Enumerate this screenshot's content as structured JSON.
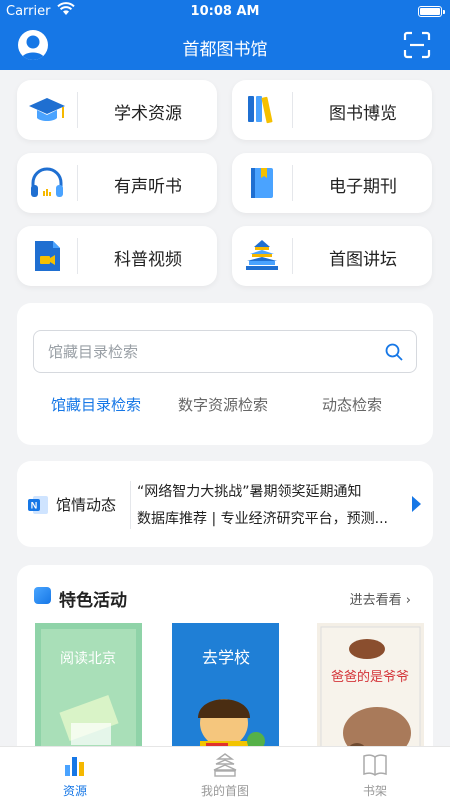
{
  "status_bar": {
    "carrier": "Carrier",
    "time": "10:08 AM"
  },
  "header": {
    "title": "首都图书馆",
    "avatar_icon": "user-avatar-icon",
    "scan_icon": "scan-icon"
  },
  "grid": [
    {
      "label": "学术资源",
      "icon": "graduation-cap-icon"
    },
    {
      "label": "图书博览",
      "icon": "books-icon"
    },
    {
      "label": "有声听书",
      "icon": "headphones-icon"
    },
    {
      "label": "电子期刊",
      "icon": "ebook-icon"
    },
    {
      "label": "科普视频",
      "icon": "video-file-icon"
    },
    {
      "label": "首图讲坛",
      "icon": "temple-icon"
    }
  ],
  "search": {
    "placeholder": "馆藏目录检索",
    "tabs": [
      "馆藏目录检索",
      "数字资源检索",
      "动态检索"
    ],
    "active_tab": "馆藏目录检索"
  },
  "news": {
    "label": "馆情动态",
    "items": [
      "“网络智力大挑战”暑期领奖延期通知",
      "数据库推荐 | 专业经济研究平台，预测..."
    ]
  },
  "featured": {
    "title": "特色活动",
    "more": "进去看看",
    "books": [
      {
        "cover_title": "阅读北京",
        "color": "#7fc99a"
      },
      {
        "cover_title": "去学校",
        "color": "#1f7fd6"
      },
      {
        "cover_title": "爸爸的是爷爷",
        "color": "#f4efe6"
      }
    ]
  },
  "tabbar": [
    {
      "label": "资源",
      "icon": "resources-chart-icon",
      "active": true
    },
    {
      "label": "我的首图",
      "icon": "library-building-icon",
      "active": false
    },
    {
      "label": "书架",
      "icon": "open-book-icon",
      "active": false
    }
  ],
  "colors": {
    "primary": "#1677e6",
    "background": "#f2f3f5"
  }
}
